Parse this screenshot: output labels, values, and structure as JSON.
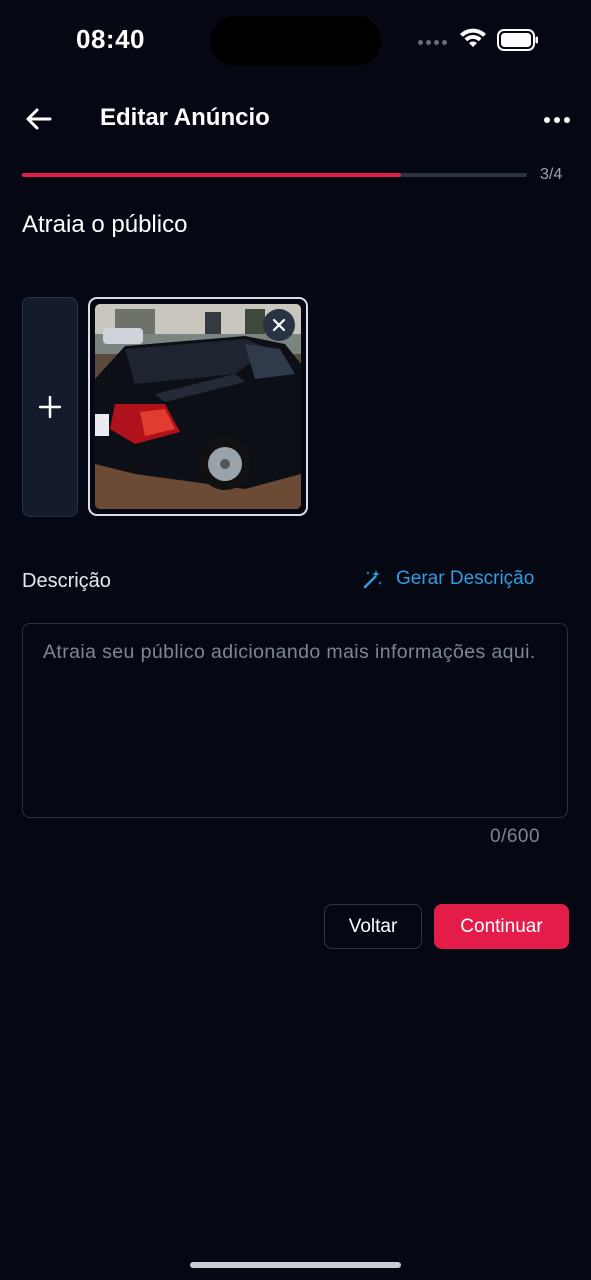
{
  "status_bar": {
    "time": "08:40"
  },
  "header": {
    "title": "Editar Anúncio",
    "back_icon": "arrow-left-icon",
    "more_icon": "more-horizontal-icon"
  },
  "progress": {
    "text": "3/4",
    "fraction": 0.75,
    "fill_color": "#e31c4a"
  },
  "section_title": "Atraia o público",
  "photos": {
    "add_icon": "plus-icon",
    "remove_icon": "close-icon",
    "items": [
      {
        "description": "black sedan rear view"
      }
    ]
  },
  "description": {
    "label": "Descrição",
    "generate_label": "Gerar Descrição",
    "generate_icon": "magic-wand-icon",
    "placeholder": "Atraia seu público adicionando mais informações aqui.",
    "value": "",
    "counter": "0/600"
  },
  "actions": {
    "back_label": "Voltar",
    "continue_label": "Continuar"
  },
  "colors": {
    "accent": "#e31c4a",
    "link": "#2f9de4",
    "background": "#050812"
  }
}
